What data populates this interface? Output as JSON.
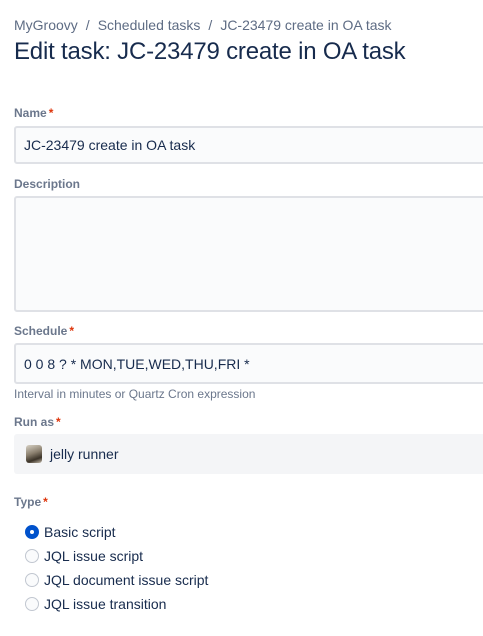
{
  "breadcrumb": {
    "items": [
      "MyGroovy",
      "Scheduled tasks",
      "JC-23479 create in OA task"
    ],
    "separator": "/"
  },
  "page_title": "Edit task: JC-23479 create in OA task",
  "form": {
    "required_marker": "*",
    "name": {
      "label": "Name",
      "value": "JC-23479 create in OA task"
    },
    "description": {
      "label": "Description",
      "value": ""
    },
    "schedule": {
      "label": "Schedule",
      "value": "0 0 8 ? * MON,TUE,WED,THU,FRI *",
      "help": "Interval in minutes or Quartz Cron expression"
    },
    "run_as": {
      "label": "Run as",
      "user": "jelly runner",
      "avatar_icon": "user-avatar-icon"
    },
    "type": {
      "label": "Type",
      "selected": 0,
      "options": [
        "Basic script",
        "JQL issue script",
        "JQL document issue script",
        "JQL issue transition"
      ]
    }
  },
  "colors": {
    "accent": "#0052cc",
    "required": "#de350b",
    "text": "#172b4d",
    "subtle_text": "#6b778c",
    "field_border": "#dfe1e6"
  }
}
